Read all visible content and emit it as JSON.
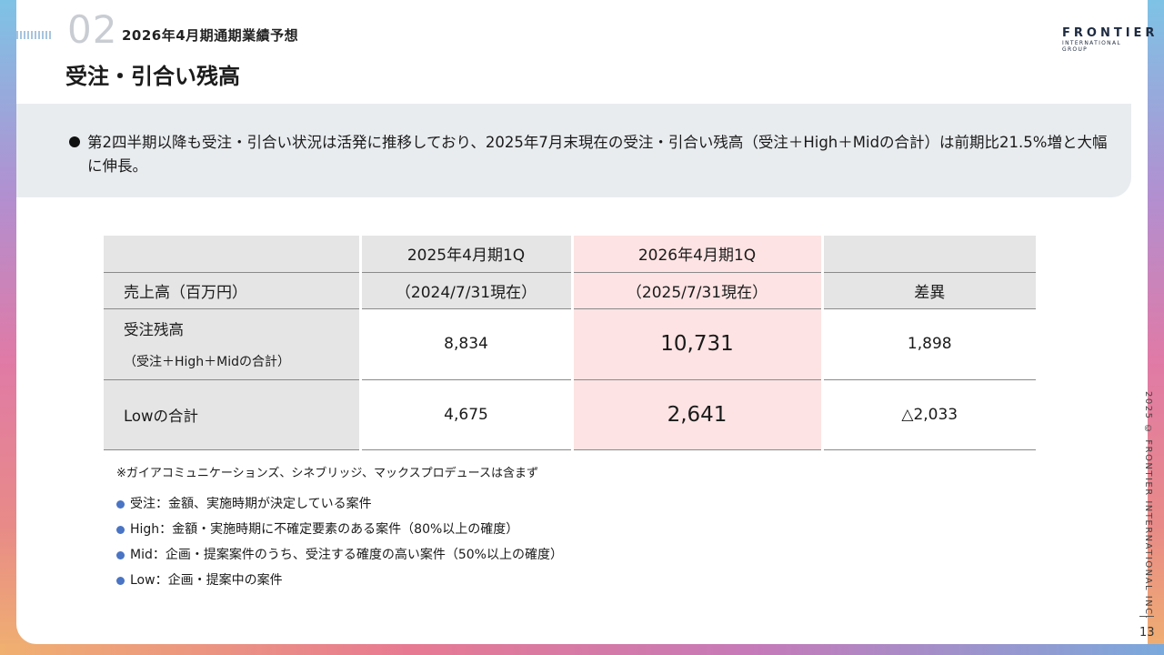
{
  "header": {
    "section_number": "02",
    "section_title": "2026年4月期通期業績予想",
    "page_title": "受注・引合い残高"
  },
  "logo": {
    "name": "FRONTIER",
    "sub": "INTERNATIONAL GROUP",
    "icon": "soundwave-logo-icon",
    "colors": [
      "#f4a6b8",
      "#9aa8e0",
      "#7ad0e0"
    ]
  },
  "summary": {
    "text": "第2四半期以降も受注・引合い状況は活発に推移しており、2025年7月末現在の受注・引合い残高（受注＋High＋Midの合計）は前期比21.5%増と大幅に伸長。"
  },
  "table": {
    "col_2025_line1": "2025年4月期1Q",
    "col_2025_line2": "（2024/7/31現在）",
    "col_2026_line1": "2026年4月期1Q",
    "col_2026_line2": "（2025/7/31現在）",
    "col_diff": "差異",
    "row_header_label": "売上高（百万円）",
    "rows": [
      {
        "label": "受注残高",
        "sublabel": "（受注＋High＋Midの合計）",
        "v2025": "8,834",
        "v2026": "10,731",
        "diff": "1,898"
      },
      {
        "label": "Lowの合計",
        "v2025": "4,675",
        "v2026": "2,641",
        "diff": "△2,033"
      }
    ],
    "colors": {
      "header_gray": "#e5e5e5",
      "highlight_pink": "#fde3e3"
    }
  },
  "footnote": "※ガイアコミュニケーションズ、シネブリッジ、マックスプロデュースは含まず",
  "legend": [
    "受注：金額、実施時期が決定している案件",
    "High：金額・実施時期に不確定要素のある案件（80%以上の確度）",
    "Mid：企画・提案案件のうち、受注する確度の高い案件（50%以上の確度）",
    "Low：企画・提案中の案件"
  ],
  "footer": {
    "copyright": "2025 © FRONTIER INTERNATIONAL INC.",
    "page_number": "13"
  }
}
